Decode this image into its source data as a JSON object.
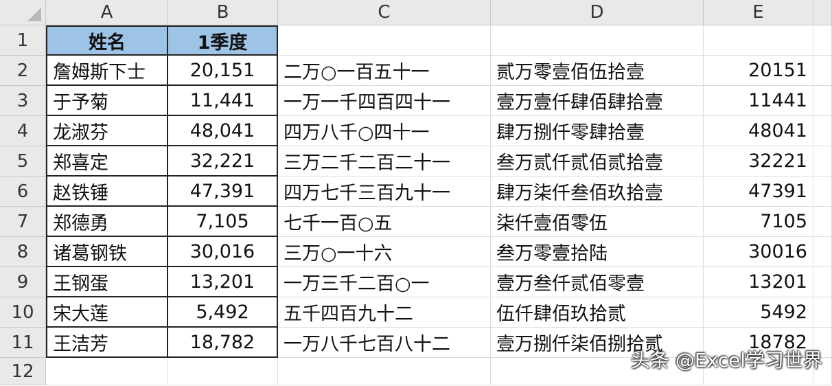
{
  "columns": [
    "A",
    "B",
    "C",
    "D",
    "E"
  ],
  "rows": [
    "1",
    "2",
    "3",
    "4",
    "5",
    "6",
    "7",
    "8",
    "9",
    "10",
    "11",
    "12"
  ],
  "header": {
    "name": "姓名",
    "q1": "1季度"
  },
  "data": [
    {
      "a": "詹姆斯下士",
      "b": "20,151",
      "c": "二万○一百五十一",
      "d": "贰万零壹佰伍拾壹",
      "e": "20151"
    },
    {
      "a": "于予菊",
      "b": "11,441",
      "c": "一万一千四百四十一",
      "d": "壹万壹仟肆佰肆拾壹",
      "e": "11441"
    },
    {
      "a": "龙淑芬",
      "b": "48,041",
      "c": "四万八千○四十一",
      "d": "肆万捌仟零肆拾壹",
      "e": "48041"
    },
    {
      "a": "郑喜定",
      "b": "32,221",
      "c": "三万二千二百二十一",
      "d": "叁万贰仟贰佰贰拾壹",
      "e": "32221"
    },
    {
      "a": "赵铁锤",
      "b": "47,391",
      "c": "四万七千三百九十一",
      "d": "肆万柒仟叁佰玖拾壹",
      "e": "47391"
    },
    {
      "a": "郑德勇",
      "b": "7,105",
      "c": "七千一百○五",
      "d": "柒仟壹佰零伍",
      "e": "7105"
    },
    {
      "a": "诸葛钢铁",
      "b": "30,016",
      "c": "三万○一十六",
      "d": "叁万零壹拾陆",
      "e": "30016"
    },
    {
      "a": "王钢蛋",
      "b": "13,201",
      "c": "一万三千二百○一",
      "d": "壹万叁仟贰佰零壹",
      "e": "13201"
    },
    {
      "a": "宋大莲",
      "b": "5,492",
      "c": "五千四百九十二",
      "d": "伍仟肆佰玖拾贰",
      "e": "5492"
    },
    {
      "a": "王洁芳",
      "b": "18,782",
      "c": "一万八千七百八十二",
      "d": "壹万捌仟柒佰捌拾贰",
      "e": "18782"
    }
  ],
  "watermark": "头条 @Excel学习世界"
}
